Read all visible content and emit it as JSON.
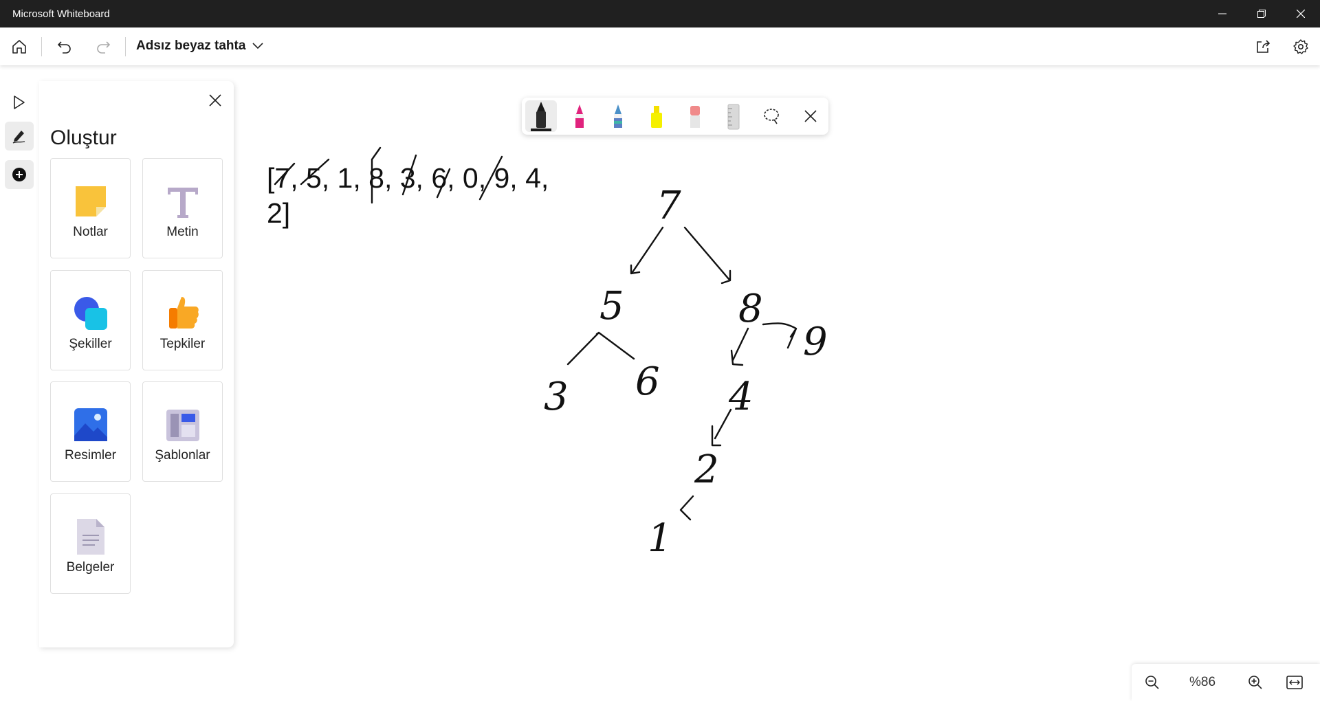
{
  "window": {
    "title": "Microsoft Whiteboard"
  },
  "topbar": {
    "board_title": "Adsız beyaz tahta"
  },
  "panel": {
    "title": "Oluştur",
    "items": [
      {
        "label": "Notlar",
        "icon": "sticky-note-icon"
      },
      {
        "label": "Metin",
        "icon": "text-icon"
      },
      {
        "label": "Şekiller",
        "icon": "shapes-icon"
      },
      {
        "label": "Tepkiler",
        "icon": "thumbs-up-icon"
      },
      {
        "label": "Resimler",
        "icon": "image-icon"
      },
      {
        "label": "Şablonlar",
        "icon": "template-icon"
      },
      {
        "label": "Belgeler",
        "icon": "document-icon"
      }
    ]
  },
  "canvas": {
    "list_line1": "[7, 5, 1, 8, 3, 6, 0, 9, 4,",
    "list_line2": "2]",
    "tree_nodes": [
      "7",
      "5",
      "8",
      "3",
      "6",
      "9",
      "4",
      "2",
      "1"
    ]
  },
  "zoom": {
    "value": "%86"
  },
  "colors": {
    "titlebar": "#202020",
    "pen_black": "#1a1a1a",
    "pen_pink": "#e0237d",
    "pen_galaxy": "#4a90c8",
    "highlighter_yellow": "#f5f000",
    "eraser": "#f08a8a"
  }
}
